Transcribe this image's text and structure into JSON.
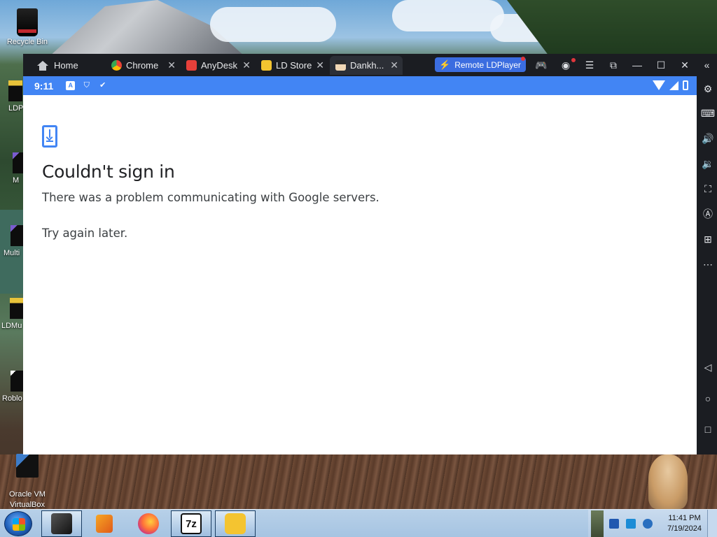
{
  "desktop": {
    "icons": [
      {
        "label": "Recycle Bin"
      },
      {
        "label": "Oracle VM\nVirtualBox"
      }
    ],
    "partial_icons": [
      "LDP",
      "M",
      "Multi",
      "LDMu",
      "Roblo"
    ]
  },
  "window": {
    "tabs": [
      {
        "label": "Home",
        "icon": "home-icon"
      },
      {
        "label": "Chrome",
        "icon": "chrome-icon"
      },
      {
        "label": "AnyDesk",
        "icon": "anydesk-icon"
      },
      {
        "label": "LD Store",
        "icon": "gamepad-icon"
      },
      {
        "label": "Dankh...",
        "icon": "app-avatar-icon"
      }
    ],
    "remote_button": "Remote LDPlayer",
    "controls": [
      "gamepad-icon",
      "account-icon",
      "menu-icon",
      "popout-icon",
      "minimize-icon",
      "maximize-icon",
      "close-icon"
    ],
    "collapse_label": "«"
  },
  "android": {
    "status": {
      "time": "9:11"
    },
    "dialog": {
      "icon": "phone-download-icon",
      "title": "Couldn't sign in",
      "message": "There was a problem communicating with Google servers.",
      "message2": "Try again later."
    }
  },
  "sidebar": {
    "buttons": [
      "settings-icon",
      "keyboard-icon",
      "volume-up-icon",
      "volume-down-icon",
      "screenshot-icon",
      "macro-icon",
      "add-apk-icon",
      "more-icon",
      "back-icon",
      "home-circle-icon",
      "recents-icon"
    ]
  },
  "taskbar": {
    "apps": [
      "ldplayer-icon",
      "media-player-icon",
      "firefox-icon",
      "7zip-icon",
      "ldplayer-logo-icon"
    ],
    "time": "11:41 PM",
    "date": "7/19/2024"
  },
  "colors": {
    "accent": "#4285f4",
    "remote_button": "#3b6de0",
    "window_chrome": "#1b1d22"
  }
}
